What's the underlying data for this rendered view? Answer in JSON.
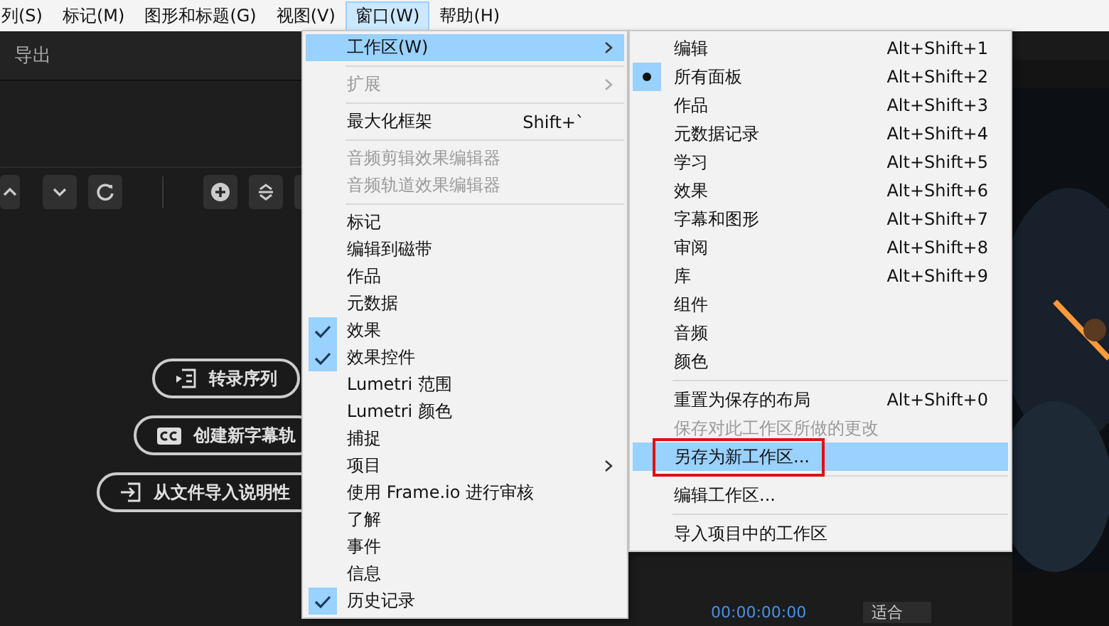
{
  "menubar": [
    {
      "label": "列(S)",
      "selected": false
    },
    {
      "label": "标记(M)",
      "selected": false
    },
    {
      "label": "图形和标题(G)",
      "selected": false
    },
    {
      "label": "视图(V)",
      "selected": false
    },
    {
      "label": "窗口(W)",
      "selected": true
    },
    {
      "label": "帮助(H)",
      "selected": false
    }
  ],
  "panel": {
    "title": "导出"
  },
  "actions": [
    {
      "label": "转录序列"
    },
    {
      "label": "创建新字幕轨"
    },
    {
      "label": "从文件导入说明性"
    }
  ],
  "monitor": {
    "timecode": "00:00:00:00",
    "zoom": "适合"
  },
  "window_menu": {
    "items": [
      {
        "kind": "item",
        "label": "工作区(W)",
        "checked": false,
        "disabled": false,
        "selected": true,
        "submenu": true
      },
      {
        "kind": "separator"
      },
      {
        "kind": "item",
        "label": "扩展",
        "checked": false,
        "disabled": true,
        "selected": false,
        "submenu": true
      },
      {
        "kind": "separator"
      },
      {
        "kind": "item",
        "label": "最大化框架",
        "shortcut": "Shift+`",
        "checked": false,
        "disabled": false,
        "selected": false,
        "submenu": false
      },
      {
        "kind": "separator"
      },
      {
        "kind": "item",
        "label": "音频剪辑效果编辑器",
        "checked": false,
        "disabled": true,
        "selected": false,
        "submenu": false
      },
      {
        "kind": "item",
        "label": "音频轨道效果编辑器",
        "checked": false,
        "disabled": true,
        "selected": false,
        "submenu": false
      },
      {
        "kind": "separator"
      },
      {
        "kind": "item",
        "label": "标记",
        "checked": false,
        "disabled": false,
        "selected": false,
        "submenu": false
      },
      {
        "kind": "item",
        "label": "编辑到磁带",
        "checked": false,
        "disabled": false,
        "selected": false,
        "submenu": false
      },
      {
        "kind": "item",
        "label": "作品",
        "checked": false,
        "disabled": false,
        "selected": false,
        "submenu": false
      },
      {
        "kind": "item",
        "label": "元数据",
        "checked": false,
        "disabled": false,
        "selected": false,
        "submenu": false
      },
      {
        "kind": "item",
        "label": "效果",
        "checked": true,
        "disabled": false,
        "selected": false,
        "submenu": false
      },
      {
        "kind": "item",
        "label": "效果控件",
        "checked": true,
        "disabled": false,
        "selected": false,
        "submenu": false
      },
      {
        "kind": "item",
        "label": "Lumetri 范围",
        "checked": false,
        "disabled": false,
        "selected": false,
        "submenu": false
      },
      {
        "kind": "item",
        "label": "Lumetri 颜色",
        "checked": false,
        "disabled": false,
        "selected": false,
        "submenu": false
      },
      {
        "kind": "item",
        "label": "捕捉",
        "checked": false,
        "disabled": false,
        "selected": false,
        "submenu": false
      },
      {
        "kind": "item",
        "label": "项目",
        "checked": false,
        "disabled": false,
        "selected": false,
        "submenu": true
      },
      {
        "kind": "item",
        "label": "使用 Frame.io 进行审核",
        "checked": false,
        "disabled": false,
        "selected": false,
        "submenu": false
      },
      {
        "kind": "item",
        "label": "了解",
        "checked": false,
        "disabled": false,
        "selected": false,
        "submenu": false
      },
      {
        "kind": "item",
        "label": "事件",
        "checked": false,
        "disabled": false,
        "selected": false,
        "submenu": false
      },
      {
        "kind": "item",
        "label": "信息",
        "checked": false,
        "disabled": false,
        "selected": false,
        "submenu": false
      },
      {
        "kind": "item",
        "label": "历史记录",
        "checked": true,
        "disabled": false,
        "selected": false,
        "submenu": false
      }
    ]
  },
  "workspace_menu": {
    "items": [
      {
        "kind": "item",
        "label": "编辑",
        "shortcut": "Alt+Shift+1",
        "checked": false,
        "disabled": false,
        "selected": false,
        "outlined": false
      },
      {
        "kind": "item",
        "label": "所有面板",
        "shortcut": "Alt+Shift+2",
        "checked": true,
        "disabled": false,
        "selected": false,
        "outlined": false
      },
      {
        "kind": "item",
        "label": "作品",
        "shortcut": "Alt+Shift+3",
        "checked": false,
        "disabled": false,
        "selected": false,
        "outlined": false
      },
      {
        "kind": "item",
        "label": "元数据记录",
        "shortcut": "Alt+Shift+4",
        "checked": false,
        "disabled": false,
        "selected": false,
        "outlined": false
      },
      {
        "kind": "item",
        "label": "学习",
        "shortcut": "Alt+Shift+5",
        "checked": false,
        "disabled": false,
        "selected": false,
        "outlined": false
      },
      {
        "kind": "item",
        "label": "效果",
        "shortcut": "Alt+Shift+6",
        "checked": false,
        "disabled": false,
        "selected": false,
        "outlined": false
      },
      {
        "kind": "item",
        "label": "字幕和图形",
        "shortcut": "Alt+Shift+7",
        "checked": false,
        "disabled": false,
        "selected": false,
        "outlined": false
      },
      {
        "kind": "item",
        "label": "审阅",
        "shortcut": "Alt+Shift+8",
        "checked": false,
        "disabled": false,
        "selected": false,
        "outlined": false
      },
      {
        "kind": "item",
        "label": "库",
        "shortcut": "Alt+Shift+9",
        "checked": false,
        "disabled": false,
        "selected": false,
        "outlined": false
      },
      {
        "kind": "item",
        "label": "组件",
        "checked": false,
        "disabled": false,
        "selected": false,
        "outlined": false
      },
      {
        "kind": "item",
        "label": "音频",
        "checked": false,
        "disabled": false,
        "selected": false,
        "outlined": false
      },
      {
        "kind": "item",
        "label": "颜色",
        "checked": false,
        "disabled": false,
        "selected": false,
        "outlined": false
      },
      {
        "kind": "separator"
      },
      {
        "kind": "item",
        "label": "重置为保存的布局",
        "shortcut": "Alt+Shift+0",
        "checked": false,
        "disabled": false,
        "selected": false,
        "outlined": false
      },
      {
        "kind": "item",
        "label": "保存对此工作区所做的更改",
        "checked": false,
        "disabled": true,
        "selected": false,
        "outlined": false
      },
      {
        "kind": "item",
        "label": "另存为新工作区...",
        "checked": false,
        "disabled": false,
        "selected": true,
        "outlined": true
      },
      {
        "kind": "separator"
      },
      {
        "kind": "item",
        "label": "编辑工作区...",
        "checked": false,
        "disabled": false,
        "selected": false,
        "outlined": false
      },
      {
        "kind": "separator"
      },
      {
        "kind": "item",
        "label": "导入项目中的工作区",
        "checked": false,
        "disabled": false,
        "selected": false,
        "outlined": false
      }
    ]
  }
}
